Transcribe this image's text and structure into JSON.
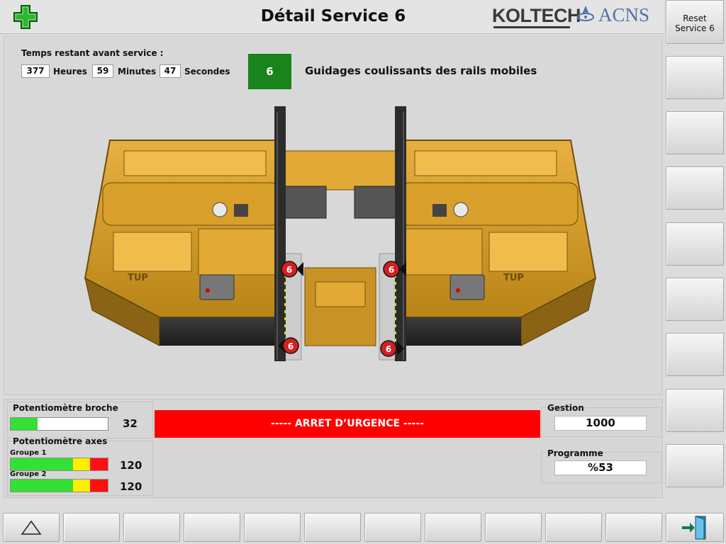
{
  "header": {
    "title": "Détail Service 6",
    "logo_koltech": "KOLTECH",
    "logo_acns": "ACNS"
  },
  "sidebar": {
    "reset_button": {
      "line1": "Reset",
      "line2": "Service 6"
    }
  },
  "timer": {
    "label": "Temps restant avant service :",
    "hours_value": "377",
    "hours_unit": "Heures",
    "minutes_value": "59",
    "minutes_unit": "Minutes",
    "seconds_value": "47",
    "seconds_unit": "Secondes"
  },
  "service": {
    "number": "6",
    "name": "Guidages coulissants des rails mobiles",
    "number_color": "#19831c",
    "markers": [
      "6",
      "6",
      "6",
      "6"
    ],
    "machine_brand": "TUP"
  },
  "spindle_pot": {
    "label": "Potentiomètre broche",
    "value": "32",
    "level_fraction": 0.28
  },
  "axes_pot": {
    "label": "Potentiomètre axes",
    "group1_label": "Groupe 1",
    "group1_value": "120",
    "group2_label": "Groupe 2",
    "group2_value": "120"
  },
  "emergency": {
    "text": "----- ARRET D’URGENCE -----",
    "color": "#ff0000"
  },
  "gestion": {
    "label": "Gestion",
    "value": "1000"
  },
  "programme": {
    "label": "Programme",
    "value": "%53"
  },
  "icons": {
    "header_left": "green-plus-icon",
    "toolbar_left": "up-triangle-icon",
    "toolbar_right": "exit-door-icon"
  }
}
